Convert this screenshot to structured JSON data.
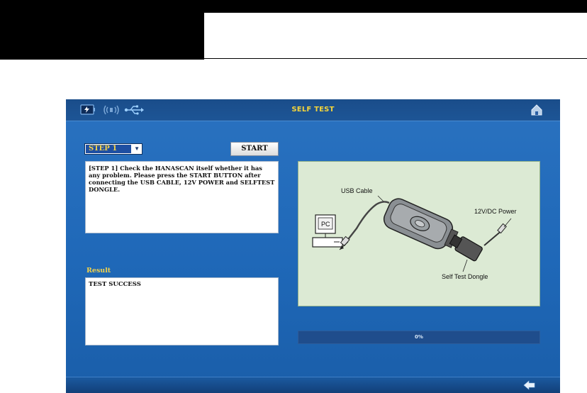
{
  "screen": {
    "title": "SELF TEST",
    "step": {
      "selected": "STEP 1",
      "icon": "chevron-down-icon"
    },
    "start_label": "START",
    "description": "[STEP 1] Check the HANASCAN itself whether it has any problem. Please press the START BUTTON after connecting the USB CABLE, 12V POWER and SELFTEST DONGLE.",
    "result": {
      "label": "Result",
      "text": "TEST SUCCESS"
    },
    "diagram": {
      "usb_label": "USB Cable",
      "pc_label": "PC",
      "power_label": "12V/DC Power",
      "dongle_label": "Self Test Dongle"
    },
    "progress": {
      "value": 0,
      "text": "0%"
    },
    "icons": {
      "titlebar": [
        "battery-icon",
        "wireless-icon",
        "usb-icon"
      ],
      "home": "home-icon",
      "back": "back-arrow-icon"
    }
  },
  "colors": {
    "title_yellow": "#f5d53a",
    "screen_blue": "#1f68b8",
    "diagram_bg": "#dcead4"
  }
}
